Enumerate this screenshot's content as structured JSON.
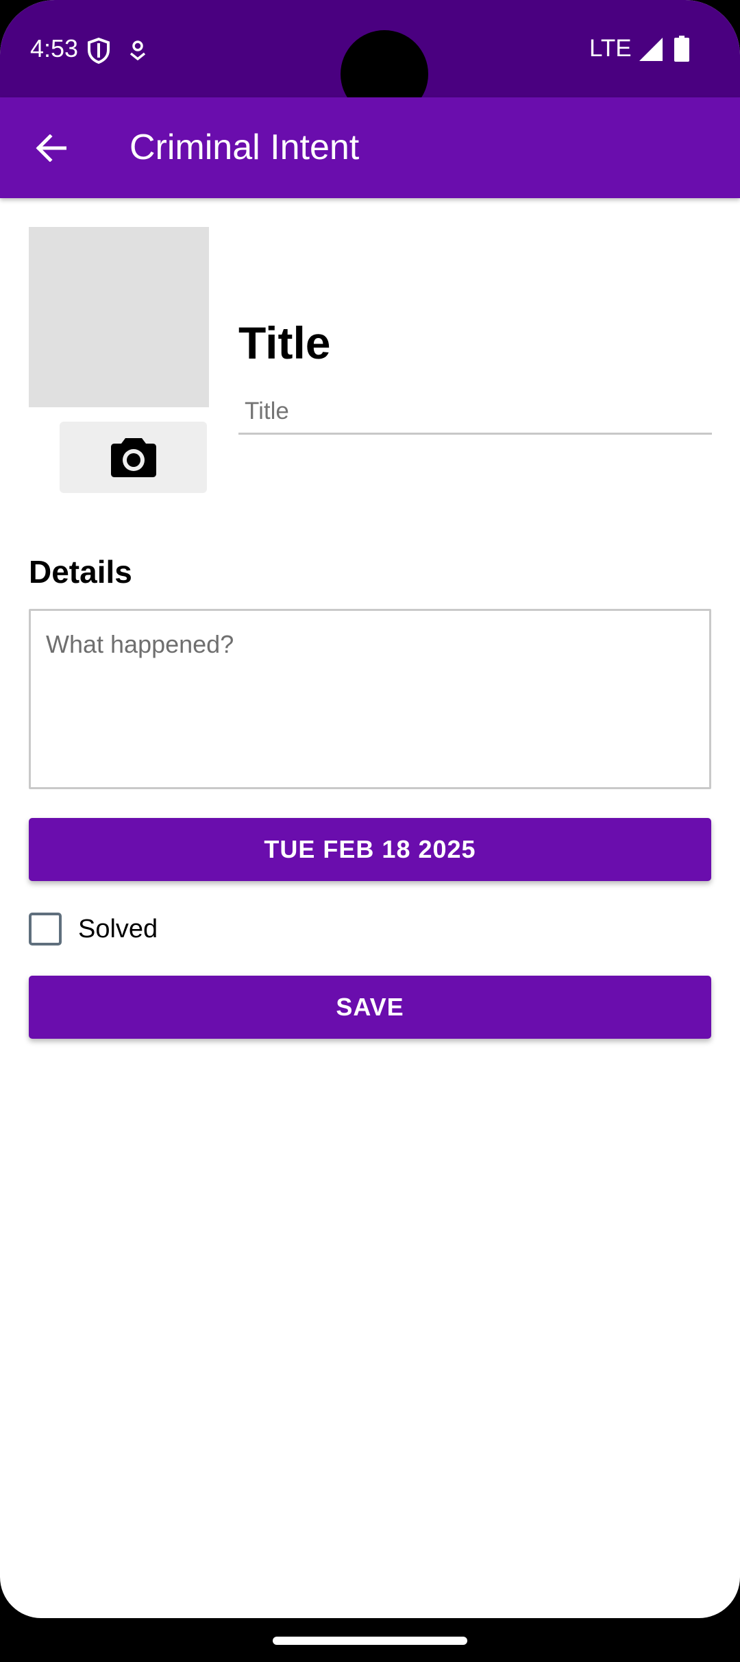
{
  "status_bar": {
    "time": "4:53",
    "left_icons": [
      "shield-icon",
      "location-pin-icon"
    ],
    "network": "LTE",
    "right_icons": [
      "signal-icon",
      "battery-icon"
    ]
  },
  "app_bar": {
    "title": "Criminal Intent",
    "back_icon": "arrow-back-icon"
  },
  "crime": {
    "photo_button_icon": "camera-icon",
    "title_label": "Title",
    "title_placeholder": "Title",
    "title_value": "",
    "details_label": "Details",
    "details_placeholder": "What happened?",
    "details_value": "",
    "date_button_label": "TUE FEB 18 2025",
    "solved_label": "Solved",
    "solved_checked": false,
    "save_button_label": "SAVE"
  },
  "colors": {
    "status_bar": "#4a0080",
    "primary": "#6a0dad",
    "photo_placeholder": "#e0e0e0",
    "camera_button_bg": "#eeeeee"
  }
}
